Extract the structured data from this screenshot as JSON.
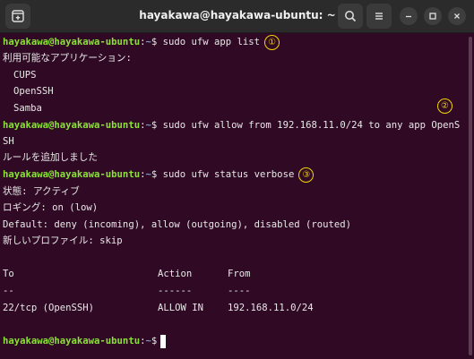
{
  "window": {
    "title": "hayakawa@hayakawa-ubuntu: ~",
    "buttons": {
      "new_tab_icon": "terminal-tab-icon",
      "search_icon": "search-icon",
      "menu_icon": "hamburger-menu-icon",
      "minimize_icon": "minimize-icon",
      "maximize_icon": "maximize-icon",
      "close_icon": "close-icon"
    }
  },
  "prompt": {
    "user": "hayakawa@hayakawa-ubuntu",
    "sep": ":",
    "path": "~",
    "symbol": "$"
  },
  "lines": {
    "cmd1": " sudo ufw app list",
    "badge1": "①",
    "out1_header": "利用可能なアプリケーション:",
    "app1": "CUPS",
    "app2": "OpenSSH",
    "app3": "Samba",
    "badge2": "②",
    "cmd2": " sudo ufw allow from 192.168.11.0/24 to any app OpenS",
    "cmd2_wrap": "SH",
    "out2": "ルールを追加しました",
    "cmd3": " sudo ufw status verbose",
    "badge3": "③",
    "status": "状態: アクティブ",
    "logging": "ロギング: on (low)",
    "default": "Default: deny (incoming), allow (outgoing), disabled (routed)",
    "new_profiles": "新しいプロファイル: skip"
  },
  "table": {
    "headers": [
      "To",
      "Action",
      "From"
    ],
    "dividers": [
      "--",
      "------",
      "----"
    ],
    "rows": [
      [
        "22/tcp (OpenSSH)",
        "ALLOW IN",
        "192.168.11.0/24"
      ]
    ]
  },
  "colors": {
    "background": "#300a24",
    "prompt_user": "#8ae234",
    "prompt_path": "#729fcf",
    "badge": "#f2d400"
  }
}
